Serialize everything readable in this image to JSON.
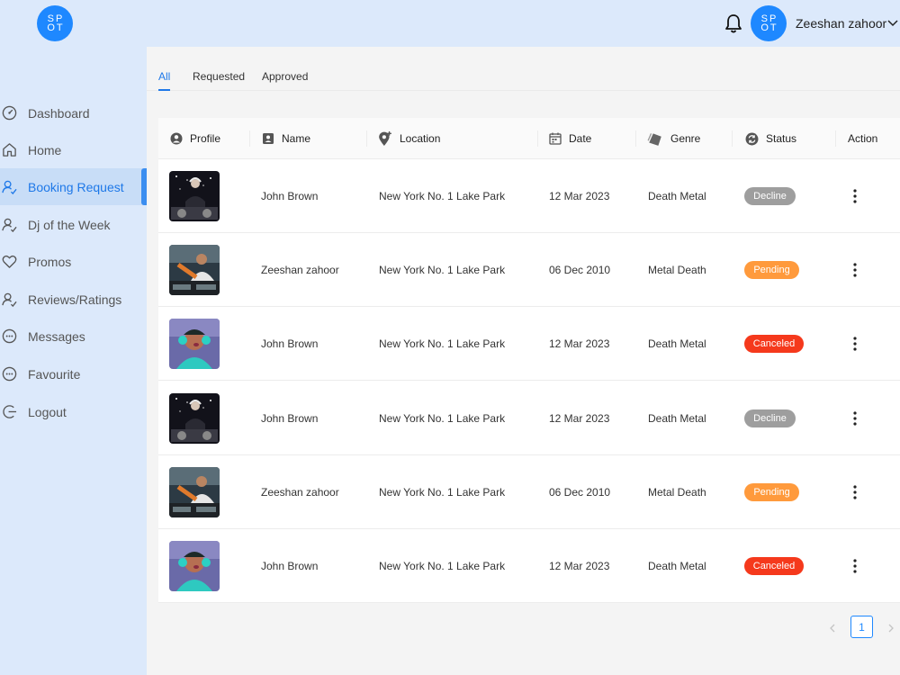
{
  "header": {
    "logo_top": "SP",
    "logo_bottom": "OT",
    "avatar_top": "SP",
    "avatar_bottom": "OT",
    "username": "Zeeshan zahoor"
  },
  "sidebar": {
    "items": [
      {
        "label": "Dashboard",
        "icon": "dashboard-icon"
      },
      {
        "label": "Home",
        "icon": "home-icon"
      },
      {
        "label": "Booking Request",
        "icon": "users-icon",
        "active": true
      },
      {
        "label": "Dj of the Week",
        "icon": "users-icon"
      },
      {
        "label": "Promos",
        "icon": "heart-icon"
      },
      {
        "label": "Reviews/Ratings",
        "icon": "users-icon"
      },
      {
        "label": "Messages",
        "icon": "chat-icon"
      },
      {
        "label": "Favourite",
        "icon": "chat-icon"
      },
      {
        "label": "Logout",
        "icon": "logout-icon"
      }
    ]
  },
  "tabs": [
    "All",
    "Requested",
    "Approved"
  ],
  "table": {
    "headers": {
      "profile": "Profile",
      "name": "Name",
      "location": "Location",
      "date": "Date",
      "genre": "Genre",
      "status": "Status",
      "action": "Action"
    },
    "rows": [
      {
        "name": "John Brown",
        "location": "New York No. 1 Lake Park",
        "date": "12 Mar 2023",
        "genre": "Death Metal",
        "status": "Decline"
      },
      {
        "name": "Zeeshan zahoor",
        "location": "New York No. 1 Lake Park",
        "date": "06 Dec 2010",
        "genre": "Metal Death",
        "status": "Pending"
      },
      {
        "name": "John Brown",
        "location": "New York No. 1 Lake Park",
        "date": "12 Mar 2023",
        "genre": "Death Metal",
        "status": "Canceled"
      },
      {
        "name": "John Brown",
        "location": "New York No. 1 Lake Park",
        "date": "12 Mar 2023",
        "genre": "Death Metal",
        "status": "Decline"
      },
      {
        "name": "Zeeshan zahoor",
        "location": "New York No. 1 Lake Park",
        "date": "06 Dec 2010",
        "genre": "Metal Death",
        "status": "Pending"
      },
      {
        "name": "John Brown",
        "location": "New York No. 1 Lake Park",
        "date": "12 Mar 2023",
        "genre": "Death Metal",
        "status": "Canceled"
      }
    ]
  },
  "status_colors": {
    "Decline": "#9e9e9e",
    "Pending": "#ff9a3c",
    "Canceled": "#f5391c"
  },
  "pagination": {
    "current_page": "1"
  },
  "colors": {
    "accent": "#1e88ff",
    "sidebar_bg": "#dce9fb"
  }
}
